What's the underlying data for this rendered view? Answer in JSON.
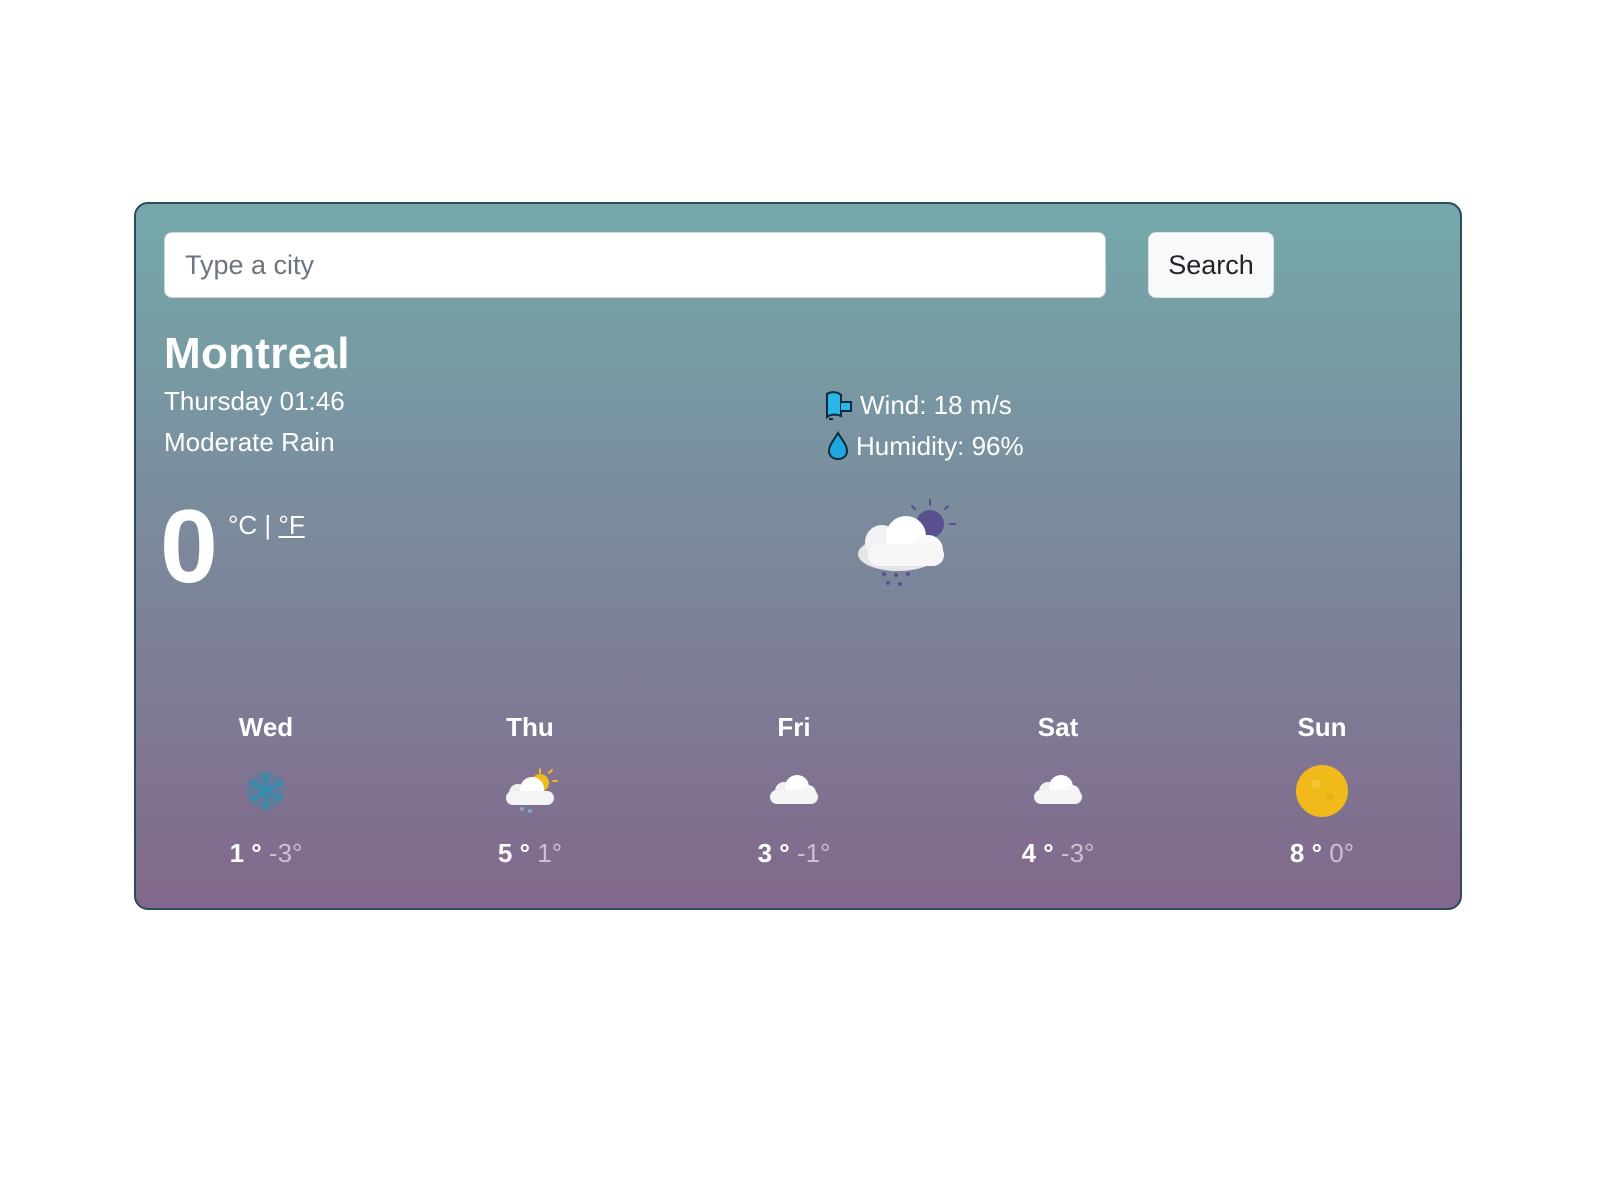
{
  "search": {
    "placeholder": "Type a city",
    "button_label": "Search"
  },
  "current": {
    "city": "Montreal",
    "datetime": "Thursday 01:46",
    "condition": "Moderate Rain",
    "temperature": "0",
    "unit_celsius": "°C",
    "unit_separator": "|",
    "unit_fahrenheit": "°F",
    "wind": "Wind: 18 m/s",
    "humidity": "Humidity: 96%",
    "icon": "cloud-moon-rain-icon"
  },
  "forecast": [
    {
      "day": "Wed",
      "max": "1",
      "max_unit": "°",
      "min": "-3°",
      "icon": "snowflake-icon"
    },
    {
      "day": "Thu",
      "max": "5",
      "max_unit": "°",
      "min": "1°",
      "icon": "cloud-sun-rain-icon"
    },
    {
      "day": "Fri",
      "max": "3",
      "max_unit": "°",
      "min": "-1°",
      "icon": "cloud-icon"
    },
    {
      "day": "Sat",
      "max": "4",
      "max_unit": "°",
      "min": "-3°",
      "icon": "cloud-icon"
    },
    {
      "day": "Sun",
      "max": "8",
      "max_unit": "°",
      "min": "0°",
      "icon": "sun-icon"
    }
  ],
  "colors": {
    "gradient_top": "#74a9aa",
    "gradient_bottom": "#82688c",
    "sun": "#f2b91a",
    "snow": "#2b8fb0"
  }
}
